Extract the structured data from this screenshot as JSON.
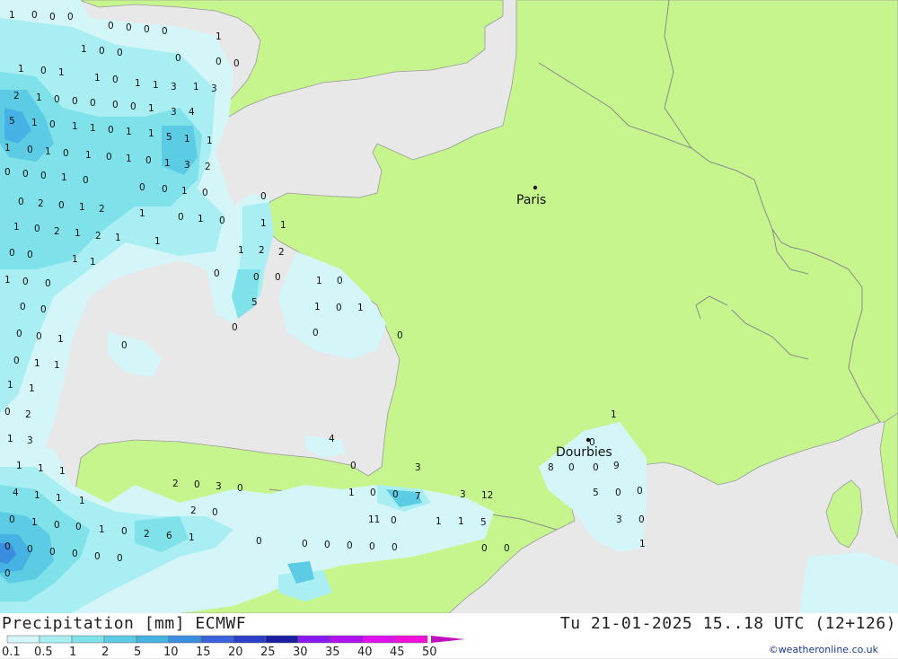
{
  "map": {
    "colors": {
      "sea": "#e8e8e8",
      "land": "#c6f58e",
      "border": "#8a8a8a"
    },
    "cities": [
      {
        "name": "Paris"
      },
      {
        "name": "Dourbies"
      }
    ],
    "value_labels": [
      "1",
      "0",
      "0",
      "0",
      "0",
      "0",
      "0",
      "0",
      "1",
      "1",
      "0",
      "0",
      "0",
      "0",
      "0",
      "1",
      "0",
      "1",
      "1",
      "0",
      "1",
      "1",
      "3",
      "1",
      "3",
      "2",
      "1",
      "0",
      "0",
      "0",
      "0",
      "0",
      "1",
      "3",
      "4",
      "5",
      "1",
      "0",
      "1",
      "1",
      "0",
      "1",
      "1",
      "5",
      "1",
      "1",
      "1",
      "0",
      "1",
      "0",
      "1",
      "0",
      "1",
      "0",
      "1",
      "3",
      "2",
      "0",
      "0",
      "0",
      "1",
      "0",
      "0",
      "0",
      "1",
      "0",
      "0",
      "2",
      "0",
      "1",
      "2",
      "1",
      "0",
      "1",
      "0",
      "1",
      "0",
      "2",
      "1",
      "2",
      "1",
      "1",
      "0",
      "0",
      "1",
      "1",
      "0",
      "1",
      "1",
      "1",
      "2",
      "2",
      "1",
      "0",
      "0",
      "0",
      "0",
      "0",
      "1",
      "0",
      "0",
      "0",
      "5",
      "1",
      "0",
      "1",
      "0",
      "0",
      "1",
      "0",
      "0",
      "0",
      "0",
      "0",
      "1",
      "1",
      "1",
      "1",
      "0",
      "2",
      "1",
      "1",
      "3",
      "4",
      "0",
      "1",
      "1",
      "1",
      "0",
      "3",
      "8",
      "0",
      "0",
      "9",
      "4",
      "1",
      "1",
      "1",
      "2",
      "0",
      "3",
      "0",
      "1",
      "0",
      "0",
      "7",
      "3",
      "12",
      "5",
      "0",
      "0",
      "0",
      "1",
      "0",
      "0",
      "1",
      "0",
      "2",
      "6",
      "1",
      "2",
      "0",
      "11",
      "0",
      "1",
      "1",
      "5",
      "3",
      "0",
      "0",
      "0",
      "0",
      "0",
      "0",
      "0",
      "0",
      "0",
      "0",
      "0",
      "0",
      "0",
      "0",
      "0",
      "1",
      "0"
    ],
    "value_label_spec": "digits are small precipitation amounts printed across the map"
  },
  "footer": {
    "title": "Precipitation [mm] ECMWF",
    "datetime": "Tu 21-01-2025 15..18 UTC (12+126)",
    "credit": "©weatheronline.co.uk",
    "legend": {
      "labels": [
        "0.1",
        "0.5",
        "1",
        "2",
        "5",
        "10",
        "15",
        "20",
        "25",
        "30",
        "35",
        "40",
        "45",
        "50"
      ],
      "colors": [
        "#d4f6f8",
        "#a8eef2",
        "#7fe2ea",
        "#5ccbe4",
        "#44b2e2",
        "#3a8ee0",
        "#3a62dc",
        "#2a3ec8",
        "#1a1ea0",
        "#8a18f0",
        "#b010f0",
        "#e010f0",
        "#f010d8",
        "#c010c0"
      ]
    }
  }
}
